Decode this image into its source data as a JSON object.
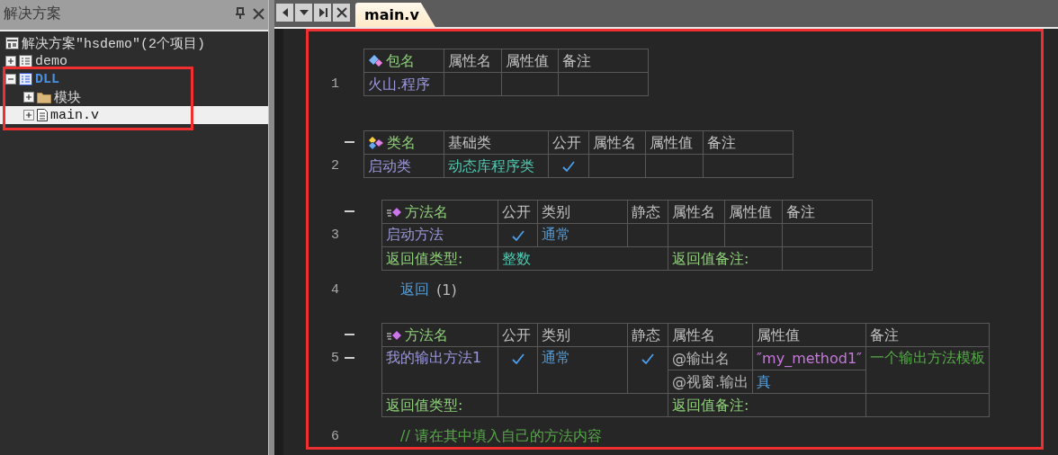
{
  "sidebar": {
    "title": "解决方案",
    "tree": [
      {
        "label": "解决方案″hsdemo″(2个项目)",
        "kind": "solution",
        "selected": false,
        "active": false,
        "children": [
          {
            "label": "demo",
            "kind": "project",
            "expanded": false,
            "selected": false,
            "active": false
          },
          {
            "label": "DLL",
            "kind": "project",
            "expanded": true,
            "selected": false,
            "active": true,
            "children": [
              {
                "label": "模块",
                "kind": "folder",
                "expanded": false,
                "selected": false,
                "active": false
              },
              {
                "label": "main.v",
                "kind": "file",
                "expanded": false,
                "selected": true,
                "active": false
              }
            ]
          }
        ]
      }
    ]
  },
  "tabs": [
    {
      "label": "main.v",
      "selected": true
    }
  ],
  "editor": {
    "blocks": [
      {
        "kind": "package",
        "number": "1",
        "fold": false,
        "header": {
          "name": "包名",
          "columns": [
            "属性名",
            "属性值",
            "备注"
          ]
        },
        "name": "火山.程序"
      },
      {
        "kind": "class",
        "number": "2",
        "fold": true,
        "header": {
          "name": "类名",
          "columns": [
            "基础类",
            "公开",
            "属性名",
            "属性值",
            "备注"
          ]
        },
        "name": "启动类",
        "base": "动态库程序类",
        "public": true
      },
      {
        "kind": "method",
        "number": "3",
        "fold": true,
        "row_fold": false,
        "header": {
          "name": "方法名",
          "columns": [
            "公开",
            "类别",
            "静态",
            "属性名",
            "属性值",
            "备注"
          ]
        },
        "name": "启动方法",
        "public": true,
        "category": "通常",
        "static": false,
        "return_type_label": "返回值类型:",
        "return_type": "整数",
        "return_note_label": "返回值备注:"
      },
      {
        "kind": "code",
        "number": "4",
        "tokens": [
          {
            "text": "返回",
            "kind": "keyword"
          },
          {
            "text": "(1)",
            "kind": "plain"
          }
        ]
      },
      {
        "kind": "method",
        "number": "5",
        "fold": true,
        "row_fold": true,
        "header": {
          "name": "方法名",
          "columns": [
            "公开",
            "类别",
            "静态",
            "属性名",
            "属性值",
            "备注"
          ]
        },
        "name": "我的输出方法1",
        "public": true,
        "category": "通常",
        "static": true,
        "attributes": [
          {
            "name": "@输出名",
            "value": "″my_method1″",
            "kind": "string"
          },
          {
            "name": "@视窗.输出",
            "value": "真",
            "kind": "constant"
          }
        ],
        "note": "一个输出方法模板",
        "return_type_label": "返回值类型:",
        "return_note_label": "返回值备注:"
      },
      {
        "kind": "code",
        "number": "6",
        "tokens": [
          {
            "text": "// 请在其中填入自己的方法内容",
            "kind": "comment"
          }
        ]
      }
    ]
  }
}
